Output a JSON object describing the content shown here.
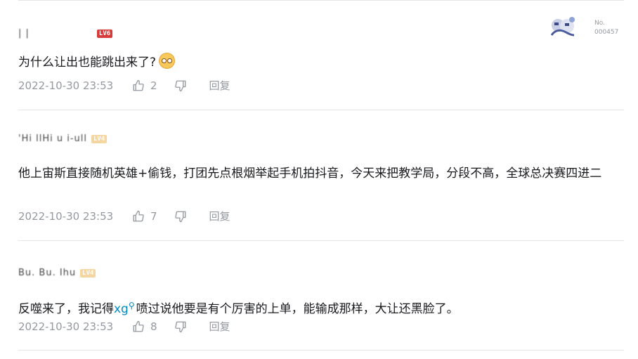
{
  "comments": [
    {
      "username": "| |",
      "level": "LV6",
      "text": "为什么让出也能跳出来了?",
      "time": "2022-10-30 23:53",
      "likes": "2",
      "reply_label": "回复"
    },
    {
      "username": "'Hi llHi u i-ull",
      "level": "LV4",
      "text": "他上宙斯直接随机英雄+偷钱，打团先点根烟举起手机拍抖音，今天来把教学局，分段不高，全球总决赛四进二",
      "time": "2022-10-30 23:53",
      "likes": "7",
      "reply_label": "回复"
    },
    {
      "username": "Bu. Bu. Ihu",
      "level": "LV4",
      "text_before": "反噬来了，我记得",
      "link": "xg",
      "text_after": "喷过说他要是有个厉害的上单，能输成那样，大让还黑脸了。",
      "time": "2022-10-30 23:53",
      "likes": "8",
      "reply_label": "回复"
    }
  ],
  "card": {
    "no_label": "No.",
    "no_value": "000457"
  },
  "colors": {
    "link": "#008ac5",
    "meta": "#9499a0",
    "divider": "#e3e5e7"
  }
}
